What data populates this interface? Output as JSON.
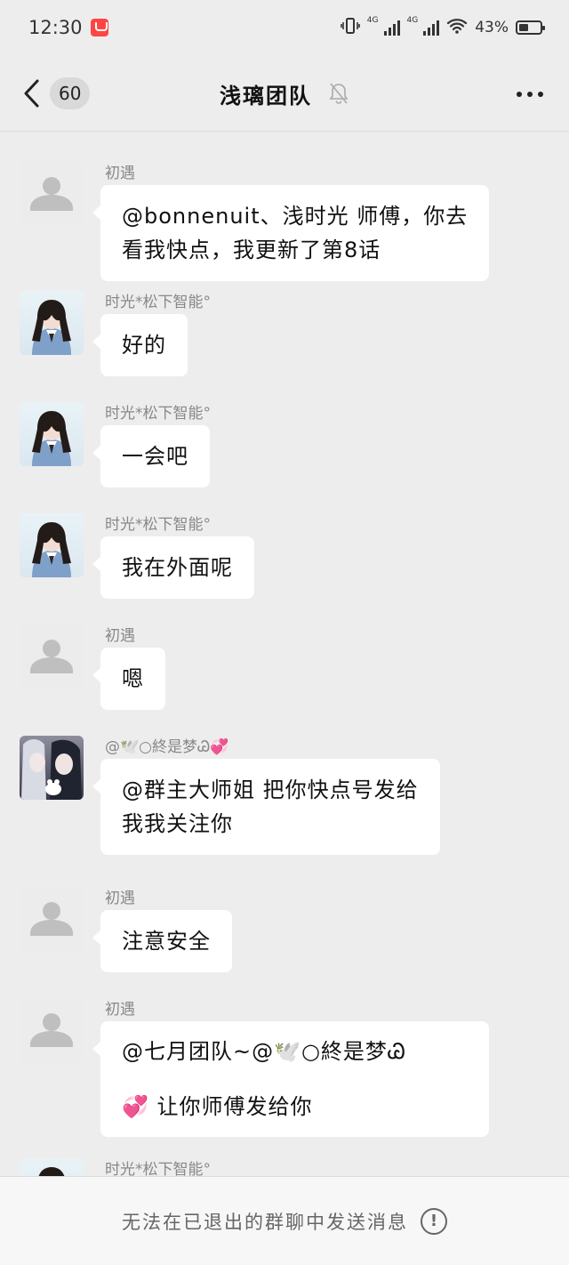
{
  "status_bar": {
    "time": "12:30",
    "network_1": "4G",
    "network_2": "4G",
    "battery_percent": "43%"
  },
  "header": {
    "back_count": "60",
    "title": "浅璃团队",
    "muted": true
  },
  "messages": [
    {
      "sender": "初遇",
      "avatar": "default-avatar",
      "lines": [
        "@bonnenuit、浅时光  师傅，你去",
        "看我快点，我更新了第8话"
      ]
    },
    {
      "sender": "时光*松下智能°",
      "avatar": "girl-avatar",
      "lines": [
        "好的"
      ]
    },
    {
      "sender": "时光*松下智能°",
      "avatar": "girl-avatar",
      "lines": [
        "一会吧"
      ]
    },
    {
      "sender": "时光*松下智能°",
      "avatar": "girl-avatar",
      "lines": [
        "我在外面呢"
      ]
    },
    {
      "sender": "初遇",
      "avatar": "default-avatar",
      "lines": [
        "嗯"
      ]
    },
    {
      "sender": "@🕊️○終是梦Ꮚ💞",
      "avatar": "anime-avatar",
      "lines": [
        "@群主大师姐  把你快点号发给",
        "我我关注你"
      ]
    },
    {
      "sender": "初遇",
      "avatar": "default-avatar",
      "lines": [
        "注意安全"
      ]
    },
    {
      "sender": "初遇",
      "avatar": "default-avatar",
      "lines": [
        "@七月团队~@🕊️○終是梦Ꮚ",
        "💞 让你师傅发给你"
      ]
    },
    {
      "sender": "时光*松下智能°",
      "avatar": "girl-avatar",
      "lines": []
    }
  ],
  "footer": {
    "notice": "无法在已退出的群聊中发送消息",
    "icon": "info-icon"
  },
  "colors": {
    "background": "#ededed",
    "bubble": "#ffffff",
    "sender_text": "#888888"
  }
}
